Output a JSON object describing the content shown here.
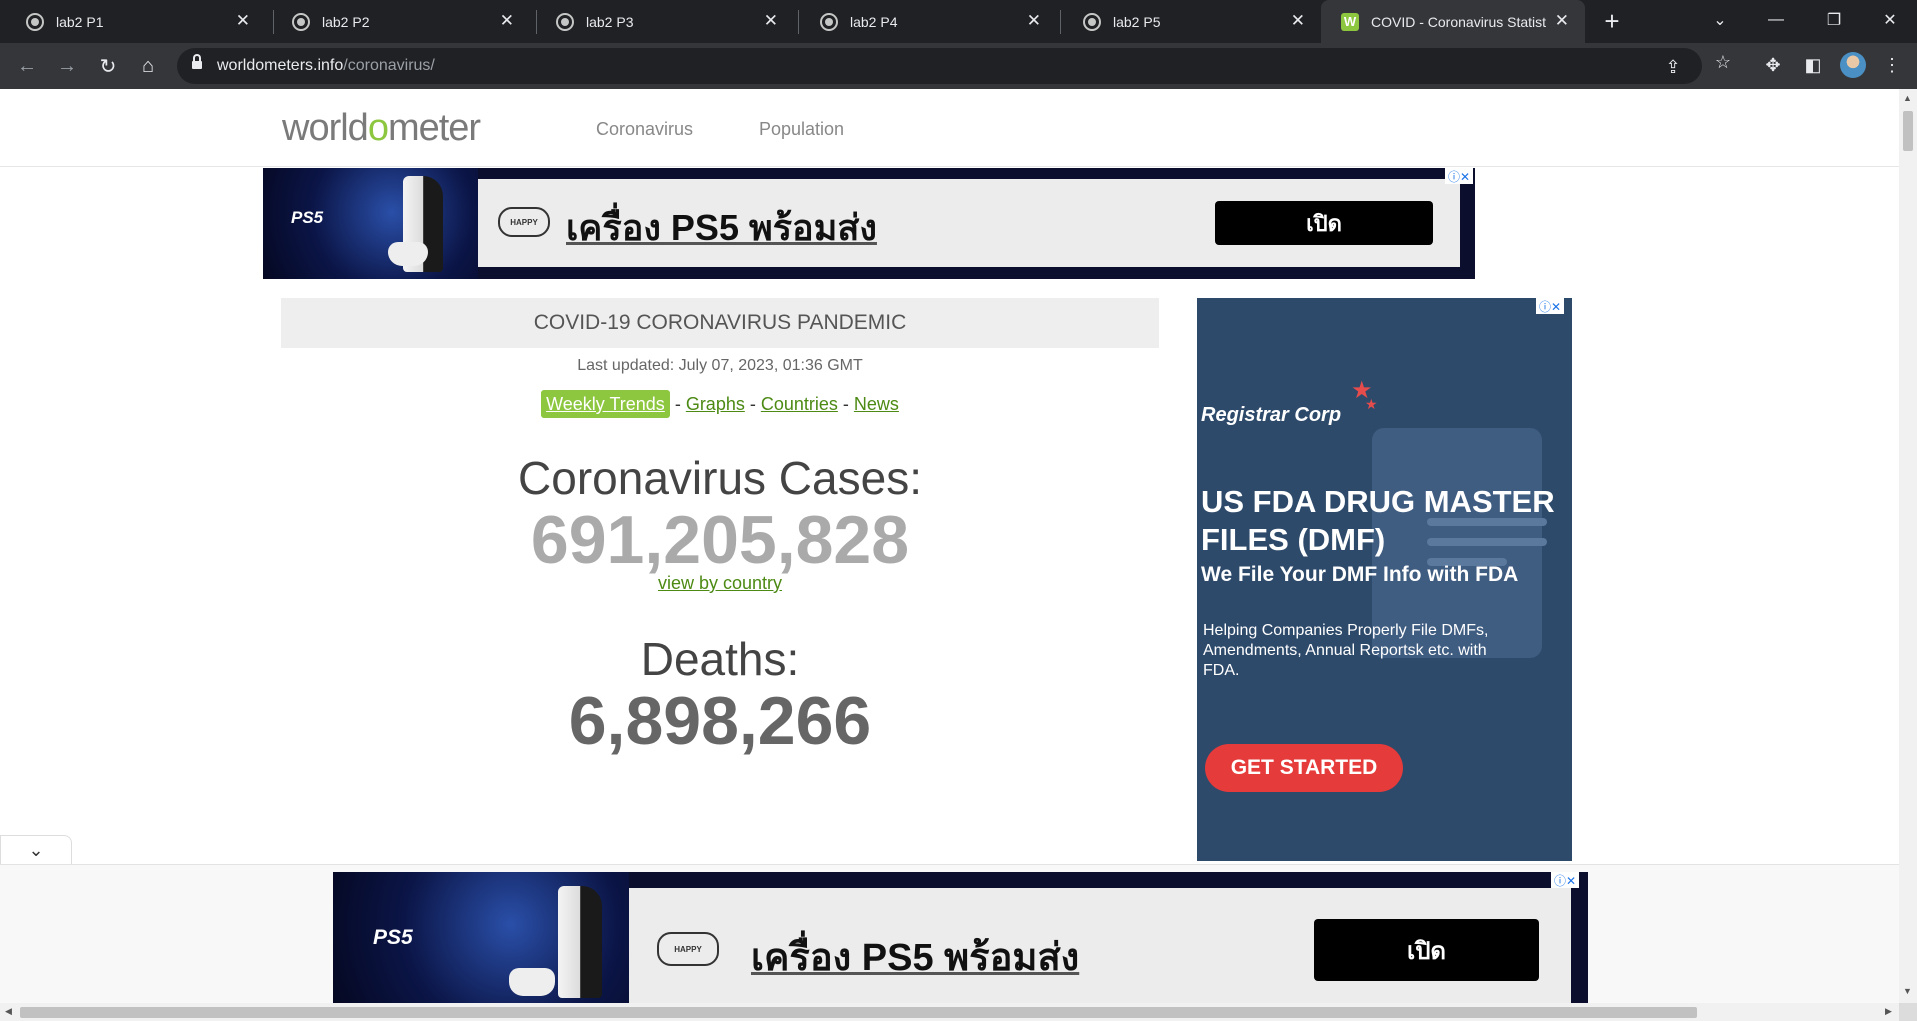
{
  "browser": {
    "tabs": [
      {
        "title": "lab2 P1"
      },
      {
        "title": "lab2 P2"
      },
      {
        "title": "lab2 P3"
      },
      {
        "title": "lab2 P4"
      },
      {
        "title": "lab2 P5"
      },
      {
        "title": "COVID - Coronavirus Statist",
        "active": true
      }
    ],
    "new_tab": "+",
    "url_host": "worldometers.info",
    "url_path": "/coronavirus/"
  },
  "header": {
    "logo_prefix": "world",
    "logo_o": "o",
    "logo_suffix": "meter",
    "nav": [
      "Coronavirus",
      "Population"
    ]
  },
  "ad_ps5": {
    "brand": "PS5",
    "badge": "HAPPY",
    "headline": "เครื่อง PS5 พร้อมส่ง",
    "cta": "เปิด"
  },
  "main": {
    "title": "COVID-19 CORONAVIRUS PANDEMIC",
    "updated": "Last updated: July 07, 2023, 01:36 GMT",
    "links": {
      "weekly_trends": "Weekly Trends",
      "sep1": " - ",
      "graphs": "Graphs",
      "sep2": " - ",
      "countries": "Countries",
      "sep3": " - ",
      "news": "News"
    },
    "cases_label": "Coronavirus Cases:",
    "cases_value": "691,205,828",
    "view_by_country": "view by country",
    "deaths_label": "Deaths:",
    "deaths_value": "6,898,266"
  },
  "ad_right": {
    "brand": "Registrar Corp",
    "headline": "US FDA DRUG MASTER FILES (DMF)",
    "subheadline": "We File Your DMF Info with FDA",
    "body": "Helping Companies Properly File DMFs, Amendments, Annual Reportsk etc. with FDA.",
    "cta": "GET STARTED"
  },
  "colors": {
    "accent_green": "#8dc63f",
    "link_green": "#4c8a14",
    "cases_gray": "#aaaaaa",
    "deaths_gray": "#666666",
    "cta_red": "#e63b3b"
  }
}
